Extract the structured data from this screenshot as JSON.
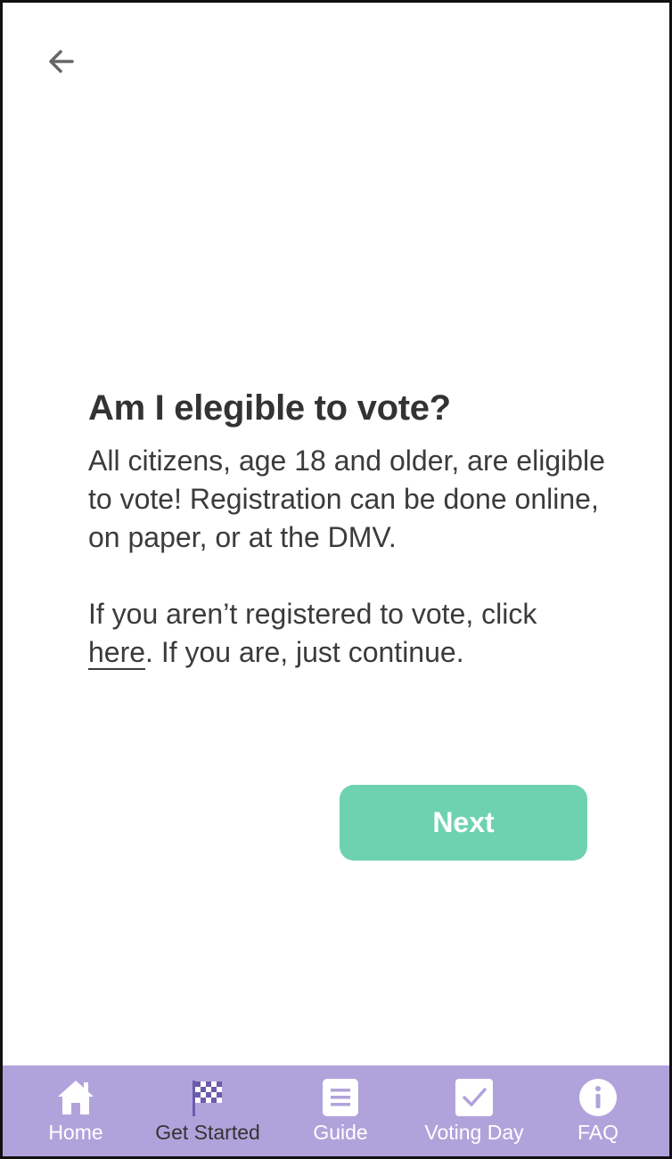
{
  "header": {
    "back_icon": "arrow-left-icon"
  },
  "main": {
    "title": "Am I elegible to vote?",
    "paragraph1": "All citizens, age 18 and older, are eligible to vote! Registration can be done online, on paper, or at the DMV.",
    "paragraph2_prefix": "If you aren’t registered to vote, click ",
    "paragraph2_link": "here",
    "paragraph2_suffix": ". If you are, just continue.",
    "next_label": "Next"
  },
  "nav": {
    "items": [
      {
        "label": "Home",
        "icon": "home-icon",
        "active": false
      },
      {
        "label": "Get Started",
        "icon": "checkered-flag-icon",
        "active": true
      },
      {
        "label": "Guide",
        "icon": "document-icon",
        "active": false
      },
      {
        "label": "Voting Day",
        "icon": "checkbox-icon",
        "active": false
      },
      {
        "label": "FAQ",
        "icon": "info-icon",
        "active": false
      }
    ]
  },
  "colors": {
    "accent_button": "#6ed2b0",
    "nav_background": "#b0a3db",
    "nav_active_label": "#333333",
    "nav_inactive_label": "#ffffff",
    "flag_icon": "#6b5bab"
  }
}
